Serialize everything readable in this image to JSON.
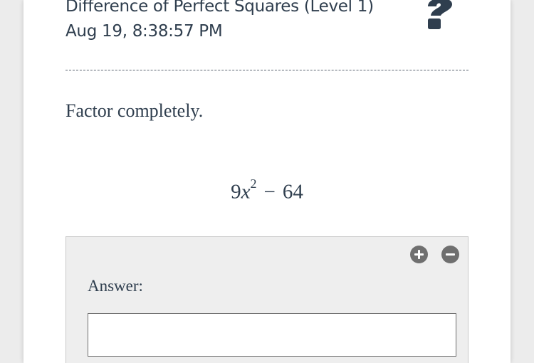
{
  "header": {
    "title": "Difference of Perfect Squares (Level 1)",
    "timestamp": "Aug 19, 8:38:57 PM",
    "help_icon": "question-mark-icon"
  },
  "question": {
    "prompt": "Factor completely.",
    "expression": {
      "coefficient": "9",
      "variable": "x",
      "exponent": "2",
      "operator": "−",
      "constant": "64"
    }
  },
  "answer": {
    "label": "Answer:",
    "value": "",
    "zoom_in_icon": "plus-circle-icon",
    "zoom_out_icon": "minus-circle-icon"
  },
  "colors": {
    "text": "#2f3e4e",
    "panel": "#eeeeee",
    "icon": "#6f6f6f",
    "background": "#ececec"
  }
}
